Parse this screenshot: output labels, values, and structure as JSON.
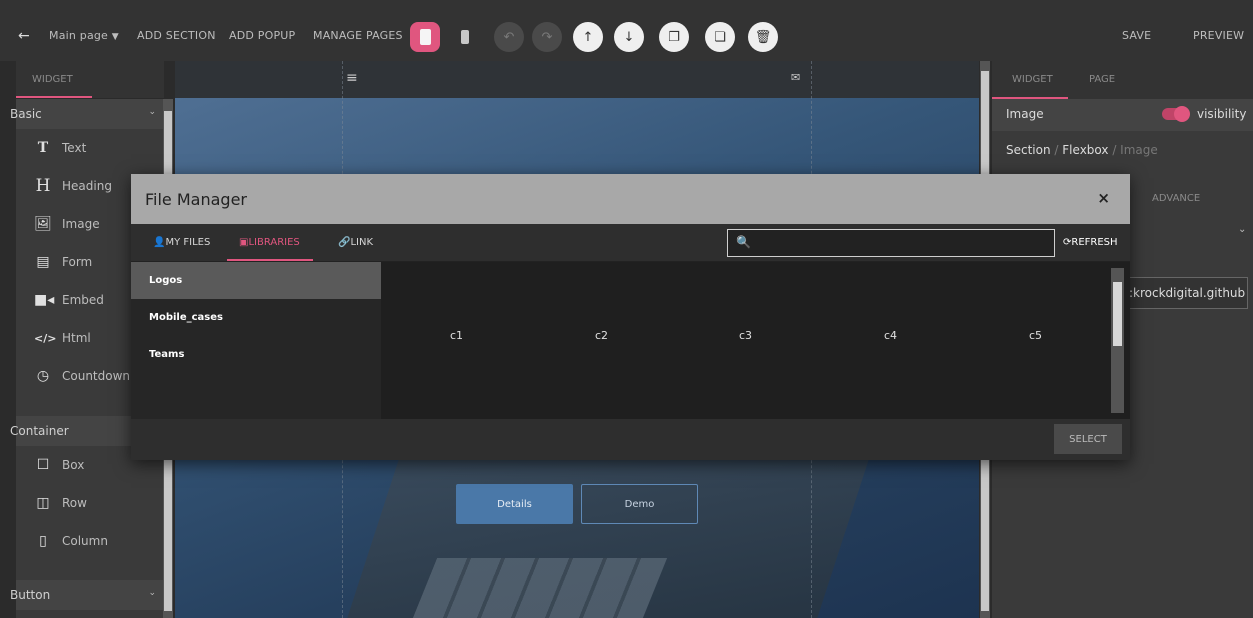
{
  "topbar": {
    "page_select": "Main page",
    "add_section": "ADD SECTION",
    "add_popup": "ADD POPUP",
    "manage_pages": "MANAGE PAGES",
    "save": "SAVE",
    "preview": "PREVIEW"
  },
  "left_panel": {
    "tab": "WIDGET",
    "basic_label": "Basic",
    "basic_items": [
      "Text",
      "Heading",
      "Image",
      "Form",
      "Embed",
      "Html",
      "Countdown"
    ],
    "container_label": "Container",
    "container_items": [
      "Box",
      "Row",
      "Column"
    ],
    "button_label": "Button"
  },
  "canvas": {
    "details_button": "Details",
    "demo_button": "Demo"
  },
  "right_panel": {
    "tab_widget": "WIDGET",
    "tab_page": "PAGE",
    "element_name": "Image",
    "visibility_label": "visibility",
    "visibility_on": true,
    "breadcrumb_section": "Section",
    "breadcrumb_flexbox": "Flexbox",
    "breadcrumb_image": "Image",
    "advance_tab": "ADVANCE",
    "url_value": ":krockdigital.github"
  },
  "file_manager": {
    "title": "File Manager",
    "tab_my_files": "MY FILES",
    "tab_libraries": "LIBRARIES",
    "tab_link": "LINK",
    "search_value": "",
    "refresh_label": "REFRESH",
    "folders": [
      "Logos",
      "Mobile_cases",
      "Teams"
    ],
    "active_folder": "Logos",
    "files": [
      "c1",
      "c2",
      "c3",
      "c4",
      "c5"
    ],
    "select_label": "SELECT"
  },
  "colors": {
    "accent": "#e0567f",
    "panel_bg": "#3a3a3a",
    "topbar_bg": "#333333"
  }
}
